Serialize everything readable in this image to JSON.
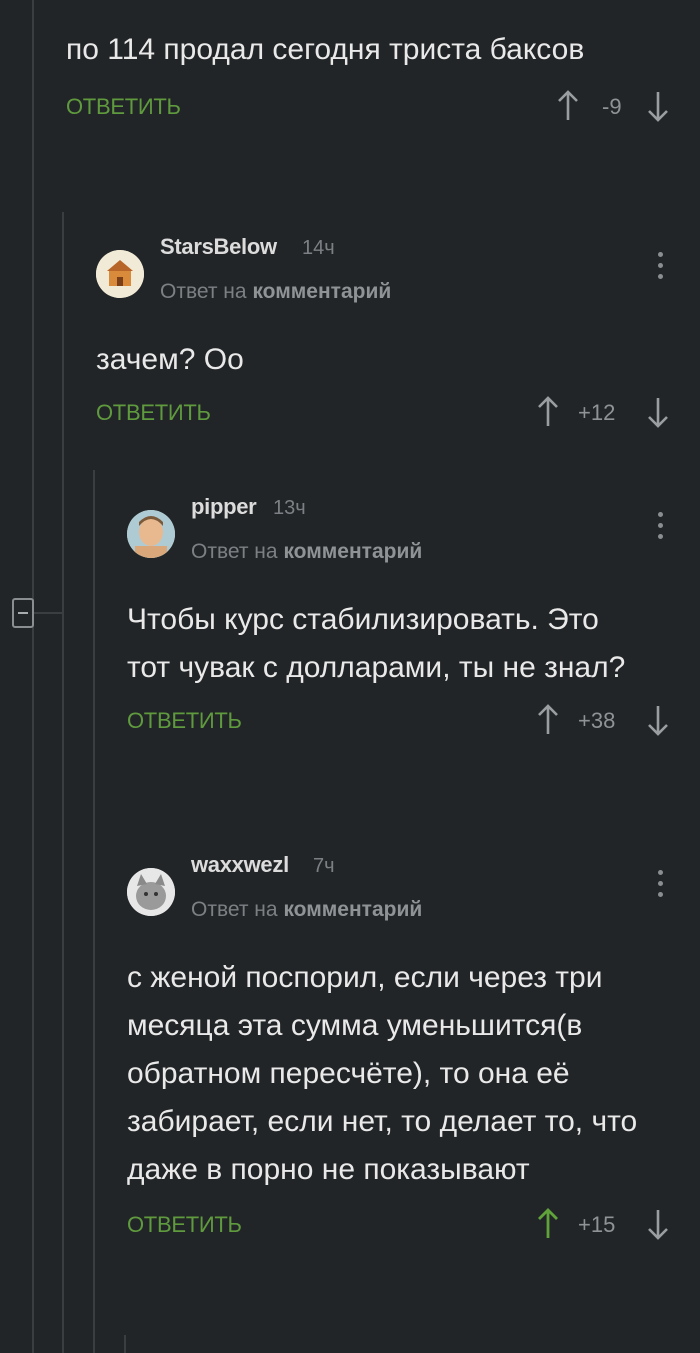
{
  "thread": {
    "collapse_label": "",
    "top_comment": {
      "text": "по 114 продал сегодня триста баксов",
      "reply_label": "ОТВЕТИТЬ",
      "score": "-9"
    },
    "replies": [
      {
        "author": "StarsBelow",
        "time": "14ч",
        "reply_prefix": "Ответ на",
        "reply_target": "комментарий",
        "text": "зачем? Оо",
        "reply_label": "ОТВЕТИТЬ",
        "score": "+12"
      },
      {
        "author": "pipper",
        "time": "13ч",
        "reply_prefix": "Ответ на",
        "reply_target": "комментарий",
        "text": "Чтобы курс стабилизировать. Это тот чувак с долларами, ты не знал?",
        "reply_label": "ОТВЕТИТЬ",
        "score": "+38"
      },
      {
        "author": "waxxwezl",
        "time": "7ч",
        "reply_prefix": "Ответ на",
        "reply_target": "комментарий",
        "text": "с женой поспорил, если через три месяца эта сумма уменьшится(в обратном пересчёте), то она её забирает, если нет, то делает то, что даже в порно не показывают",
        "reply_label": "ОТВЕТИТЬ",
        "score": "+15",
        "upvoted": true
      }
    ]
  },
  "colors": {
    "background": "#222527",
    "reply_green": "#5f9b3e",
    "upvote_active": "#5fa33a",
    "muted": "#7c8084"
  }
}
